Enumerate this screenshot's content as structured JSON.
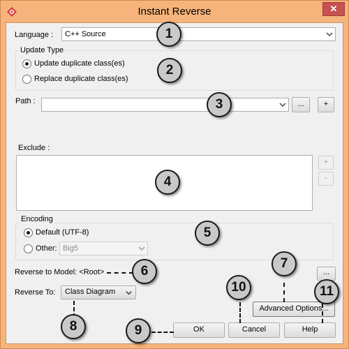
{
  "window": {
    "title": "Instant Reverse",
    "close_label": "✕"
  },
  "language": {
    "label": "Language :",
    "value": "C++ Source"
  },
  "update_type": {
    "label": "Update Type",
    "options": [
      {
        "label": "Update duplicate class(es)",
        "selected": true
      },
      {
        "label": "Replace duplicate class(es)",
        "selected": false
      }
    ]
  },
  "path": {
    "label": "Path :",
    "value": "",
    "browse_label": "...",
    "add_label": "+"
  },
  "exclude": {
    "label": "Exclude :",
    "add_label": "+",
    "remove_label": "-"
  },
  "encoding": {
    "label": "Encoding",
    "default_label": "Default (UTF-8)",
    "other_label": "Other:",
    "other_value": "Big5",
    "default_selected": true
  },
  "reverse_to_model": {
    "label": "Reverse to Model: <Root>",
    "browse_label": "..."
  },
  "reverse_to": {
    "label": "Reverse To:",
    "value": "Class Diagram"
  },
  "buttons": {
    "advanced": "Advanced Options...",
    "ok": "OK",
    "cancel": "Cancel",
    "help": "Help"
  },
  "callouts": [
    "1",
    "2",
    "3",
    "4",
    "5",
    "6",
    "7",
    "8",
    "9",
    "10",
    "11"
  ],
  "colors": {
    "window_frame": "#f6b47c",
    "close_button": "#c75050",
    "callout_fill": "#c9c9c9"
  }
}
